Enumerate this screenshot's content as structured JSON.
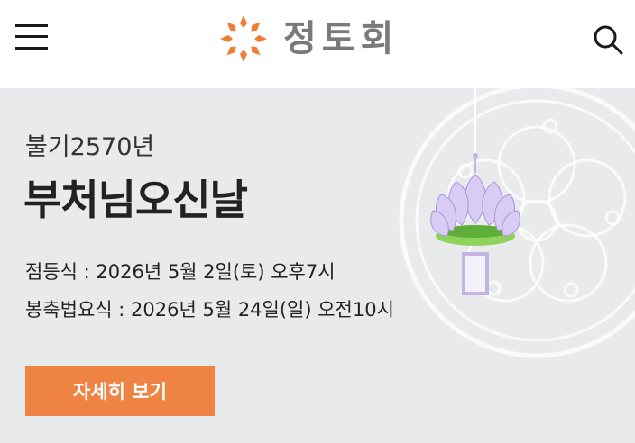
{
  "header": {
    "brand": "정토회",
    "logo_color": "#ef7d33",
    "menu_icon": "hamburger-menu-icon",
    "search_icon": "search-icon"
  },
  "event": {
    "year": "불기2570년",
    "title": "부처님오신날",
    "ceremony_lantern": "점등식 : 2026년 5월 2일(토) 오후7시",
    "ceremony_main": "봉축법요식 : 2026년 5월 24일(일) 오전10시",
    "button_label": "자세히 보기",
    "button_color": "#ef8344"
  }
}
